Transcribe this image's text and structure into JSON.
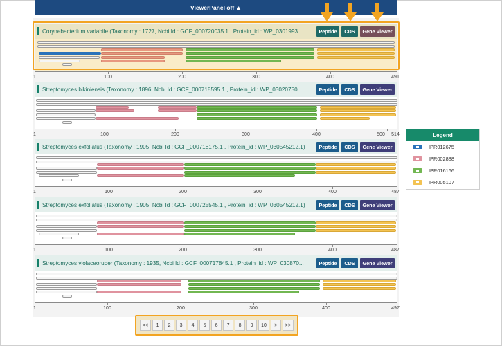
{
  "viewer_panel": {
    "label": "ViewerPanel off ▲"
  },
  "buttons": {
    "peptide": "Peptide",
    "cds": "CDS",
    "gene_viewer": "Gene Viewer"
  },
  "cards": [
    {
      "title": "Corynebacterium variabile (Taxonomy : 1727, Ncbi Id : GCF_000720035.1 , Protein_id : WP_0301993...",
      "ticks": [
        "1",
        "100",
        "200",
        "300",
        "400",
        "491"
      ]
    },
    {
      "title": "Streptomyces bikiniensis (Taxonomy : 1896, Ncbi Id : GCF_000718595.1 , Protein_id : WP_03020750...",
      "ticks": [
        "1",
        "100",
        "200",
        "300",
        "400",
        "500",
        "514"
      ]
    },
    {
      "title": "Streptomyces exfoliatus (Taxonomy : 1905, Ncbi Id : GCF_000718175.1 , Protein_id : WP_030545212.1)",
      "ticks": [
        "1",
        "100",
        "200",
        "300",
        "400",
        "487"
      ]
    },
    {
      "title": "Streptomyces exfoliatus (Taxonomy : 1905, Ncbi Id : GCF_000725545.1 , Protein_id : WP_030545212.1)",
      "ticks": [
        "1",
        "100",
        "200",
        "300",
        "400",
        "487"
      ]
    },
    {
      "title": "Streptomyces violaceoruber (Taxonomy : 1935, Ncbi Id : GCF_000717845.1 , Protein_id : WP_030870...",
      "ticks": [
        "1",
        "100",
        "200",
        "300",
        "400",
        "497"
      ]
    }
  ],
  "legend": {
    "title": "Legend",
    "items": [
      {
        "label": "IPR012675",
        "color": "#2a73ba"
      },
      {
        "label": "IPR002888",
        "color": "#e0939f"
      },
      {
        "label": "IPR016166",
        "color": "#72b752"
      },
      {
        "label": "IPR005107",
        "color": "#f3c353"
      }
    ]
  },
  "pagination": {
    "items": [
      "<<",
      "1",
      "2",
      "3",
      "4",
      "5",
      "6",
      "7",
      "8",
      "9",
      "10",
      ">",
      ">>"
    ]
  }
}
